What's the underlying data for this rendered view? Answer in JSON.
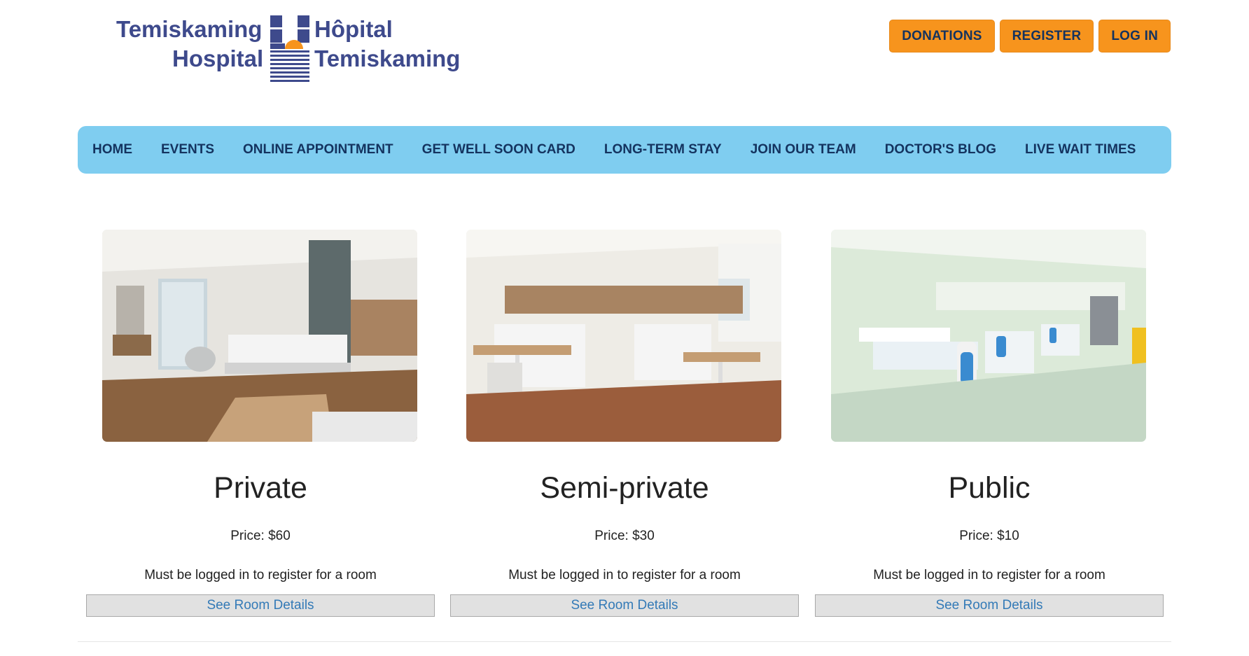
{
  "logo": {
    "en_line1": "Temiskaming",
    "en_line2": "Hospital",
    "fr_line1": "Hôpital",
    "fr_line2": "Temiskaming"
  },
  "top_actions": [
    "DONATIONS",
    "REGISTER",
    "LOG IN"
  ],
  "nav": [
    "HOME",
    "EVENTS",
    "ONLINE APPOINTMENT",
    "GET WELL SOON CARD",
    "LONG-TERM STAY",
    "JOIN OUR TEAM",
    "DOCTOR'S BLOG",
    "LIVE WAIT TIMES"
  ],
  "rooms": [
    {
      "title": "Private",
      "price": "Price: $60",
      "note": "Must be logged in to register for a room",
      "button": "See Room Details"
    },
    {
      "title": "Semi-private",
      "price": "Price: $30",
      "note": "Must be logged in to register for a room",
      "button": "See Room Details"
    },
    {
      "title": "Public",
      "price": "Price: $10",
      "note": "Must be logged in to register for a room",
      "button": "See Room Details"
    }
  ],
  "colors": {
    "accent": "#f7941d",
    "nav_bg": "#7fcdf0",
    "nav_text": "#14335f",
    "logo_blue": "#3e4a8c",
    "link": "#337ab7"
  },
  "icons": {
    "logo_mark": "hospital-cross-sun-logo-icon"
  }
}
